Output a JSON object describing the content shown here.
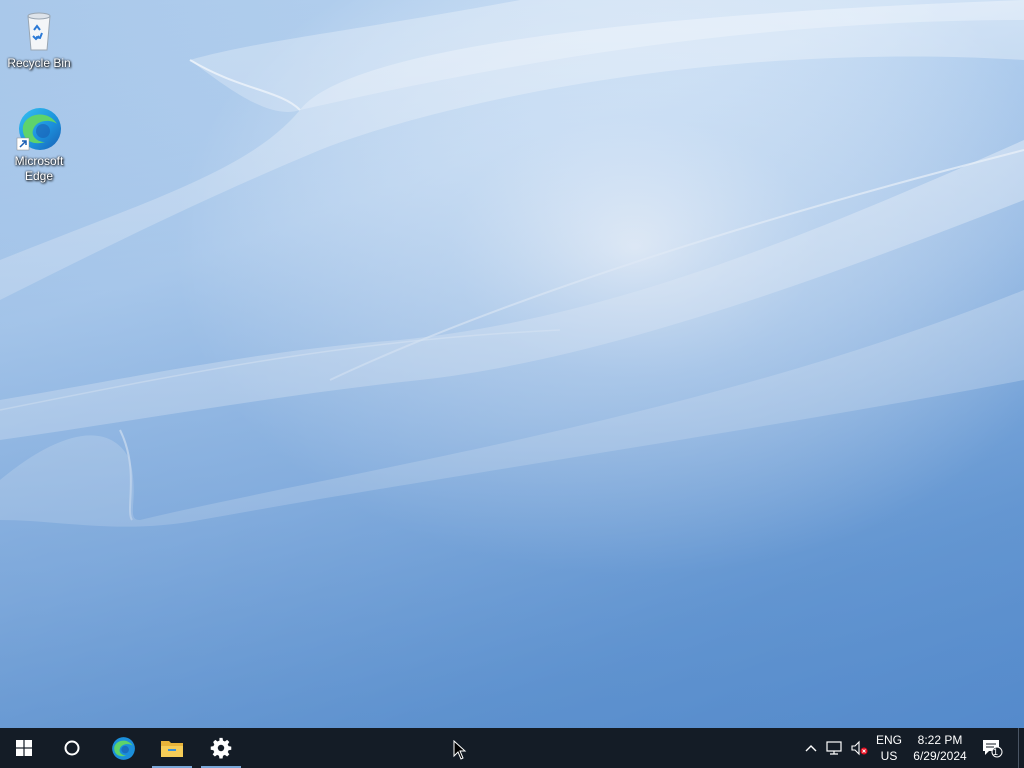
{
  "desktop": {
    "icons": [
      {
        "label": "Recycle Bin",
        "icon": "recycle-bin-icon"
      },
      {
        "label": "Microsoft Edge",
        "icon": "edge-icon"
      }
    ]
  },
  "taskbar": {
    "start": {
      "icon": "windows-start-icon"
    },
    "search": {
      "icon": "cortana-circle-icon"
    },
    "pinned": [
      {
        "name": "Microsoft Edge",
        "icon": "edge-icon",
        "active": false
      },
      {
        "name": "File Explorer",
        "icon": "folder-icon",
        "active": true
      },
      {
        "name": "Settings",
        "icon": "gear-icon",
        "active": true
      }
    ],
    "tray": {
      "language_top": "ENG",
      "language_bottom": "US",
      "time": "8:22 PM",
      "date": "6/29/2024",
      "notification_count": "1"
    }
  },
  "colors": {
    "taskbar": "#141c26",
    "active_indicator": "#7aa7d8",
    "wallpaper": "#9fc1e8"
  }
}
